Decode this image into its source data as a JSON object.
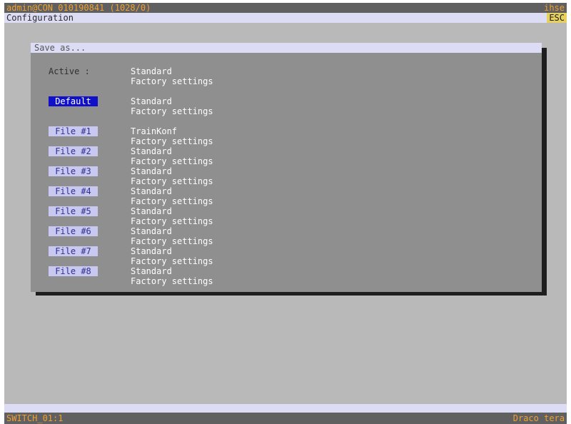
{
  "header": {
    "session": "admin@CON 010190841 (1028/0)",
    "brand": "ihse",
    "section": "Configuration",
    "esc": "ESC"
  },
  "dialog": {
    "title": "Save as...",
    "active": {
      "label": "Active :",
      "name": "Standard",
      "detail": "Factory settings"
    },
    "default": {
      "label": "Default",
      "name": "Standard",
      "detail": "Factory settings"
    },
    "files": [
      {
        "label": "File #1",
        "name": "TrainKonf",
        "detail": "Factory settings"
      },
      {
        "label": "File #2",
        "name": "Standard",
        "detail": "Factory settings"
      },
      {
        "label": "File #3",
        "name": "Standard",
        "detail": "Factory settings"
      },
      {
        "label": "File #4",
        "name": "Standard",
        "detail": "Factory settings"
      },
      {
        "label": "File #5",
        "name": "Standard",
        "detail": "Factory settings"
      },
      {
        "label": "File #6",
        "name": "Standard",
        "detail": "Factory settings"
      },
      {
        "label": "File #7",
        "name": "Standard",
        "detail": "Factory settings"
      },
      {
        "label": "File #8",
        "name": "Standard",
        "detail": "Factory settings"
      }
    ]
  },
  "status": {
    "device": "SWITCH_01:1",
    "product": "Draco tera"
  },
  "colors": {
    "topbar_bg": "#606060",
    "accent_text": "#f0a030",
    "light_bar": "#dcdcf5",
    "dialog_bg": "#8f8f8f",
    "selected_bg": "#1010c8",
    "button_bg": "#c8c8f0"
  }
}
